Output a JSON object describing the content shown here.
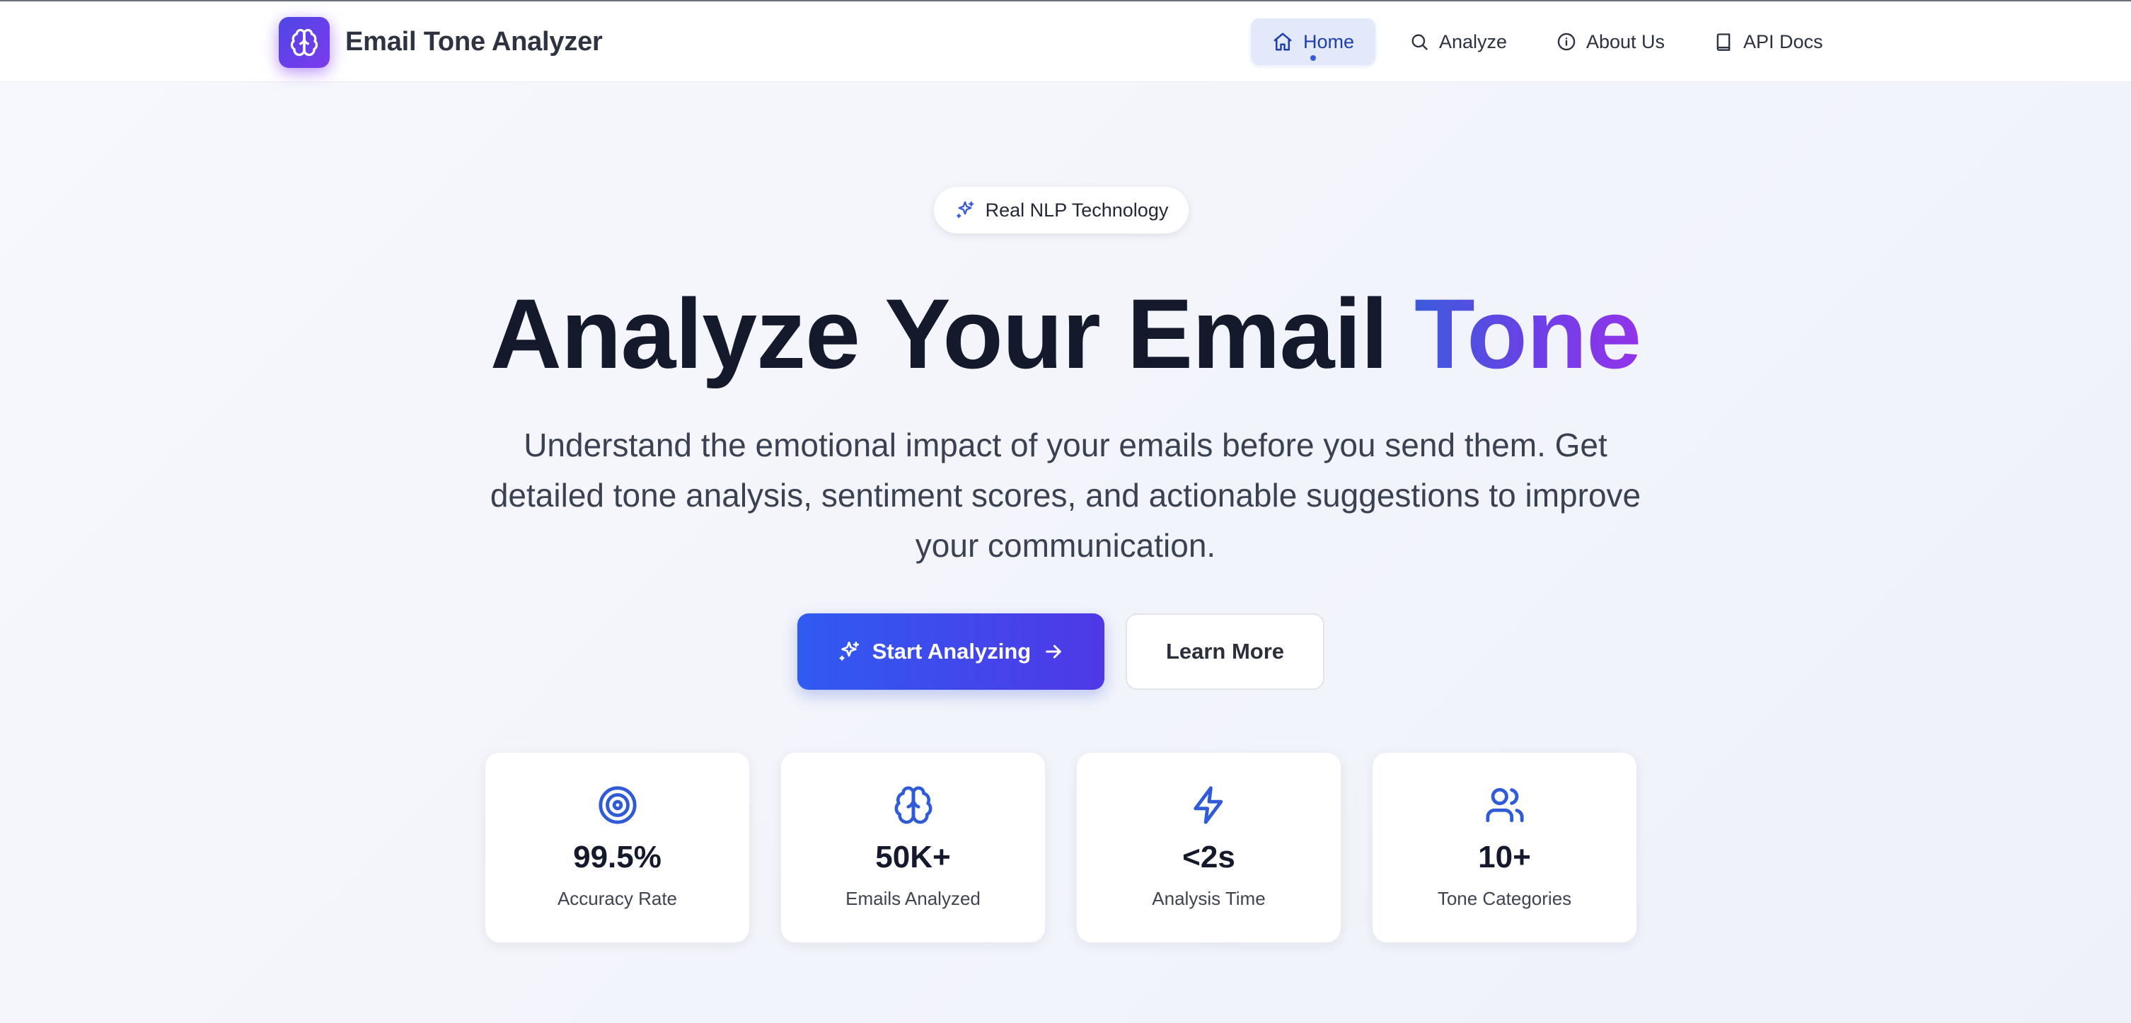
{
  "app": {
    "title": "Email Tone Analyzer",
    "brand_icon": "brain-icon"
  },
  "nav": {
    "items": [
      {
        "label": "Home",
        "icon": "home-icon",
        "active": true
      },
      {
        "label": "Analyze",
        "icon": "search-icon",
        "active": false
      },
      {
        "label": "About Us",
        "icon": "info-icon",
        "active": false
      },
      {
        "label": "API Docs",
        "icon": "book-icon",
        "active": false
      }
    ]
  },
  "hero": {
    "badge": "Real NLP Technology",
    "title_main": "Analyze Your Email",
    "title_accent": "Tone",
    "subtitle": "Understand the emotional impact of your emails before you send them. Get detailed tone analysis, sentiment scores, and actionable suggestions to improve your communication.",
    "primary_cta": "Start Analyzing",
    "secondary_cta": "Learn More"
  },
  "stats": [
    {
      "value": "99.5%",
      "label": "Accuracy Rate",
      "icon": "target-icon"
    },
    {
      "value": "50K+",
      "label": "Emails Analyzed",
      "icon": "brain-icon"
    },
    {
      "value": "<2s",
      "label": "Analysis Time",
      "icon": "lightning-icon"
    },
    {
      "value": "10+",
      "label": "Tone Categories",
      "icon": "users-icon"
    }
  ],
  "colors": {
    "accent": "#3b5bdb",
    "accent_purple": "#9333ea",
    "heading": "#141a2b",
    "body_text": "#3a4150"
  }
}
